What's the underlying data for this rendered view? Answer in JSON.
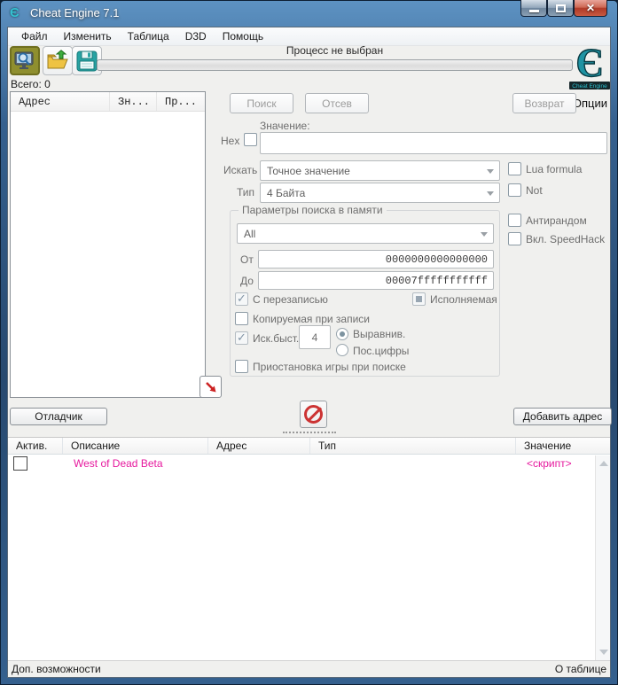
{
  "window": {
    "title": "Cheat Engine 7.1"
  },
  "menu": {
    "items": [
      "Файл",
      "Изменить",
      "Таблица",
      "D3D",
      "Помощь"
    ]
  },
  "toolbar": {
    "process_status": "Процесс не выбран",
    "progress_percent": 0,
    "icons": [
      "select-process",
      "open-table",
      "save-table"
    ]
  },
  "logo": {
    "glyph": "Є",
    "caption": "Cheat Engine",
    "options_label": "Опции"
  },
  "found": {
    "total_label": "Всего: 0",
    "columns": {
      "address": "Адрес",
      "value": "Зн...",
      "previous": "Пр..."
    }
  },
  "scan": {
    "first_scan_label": "Поиск",
    "next_scan_label": "Отсев",
    "undo_label": "Возврат",
    "value_label": "Значение:",
    "hex_label": "Hex",
    "value_input": "",
    "scan_type_label": "Искать",
    "scan_type_value": "Точное значение",
    "value_type_label": "Тип",
    "value_type_value": "4 Байта",
    "lua_formula_label": "Lua formula",
    "not_label": "Not",
    "antirandom_label": "Антирандом",
    "speedhack_label": "Вкл. SpeedHack",
    "memory_group_title": "Параметры поиска в памяти",
    "region_value": "All",
    "from_label": "От",
    "from_value": "0000000000000000",
    "to_label": "До",
    "to_value": "00007fffffffffff",
    "writable_label": "С перезаписью",
    "executable_label": "Исполняемая",
    "copy_on_write_label": "Копируемая при записи",
    "fast_scan_label": "Иск.быст.",
    "fast_scan_value": "4",
    "aligned_label": "Выравнив.",
    "last_digits_label": "Пос.цифры",
    "pause_label": "Приостановка игры при поиске"
  },
  "actions": {
    "debugger_label": "Отладчик",
    "add_address_label": "Добавить адрес"
  },
  "table": {
    "columns": {
      "active": "Актив.",
      "description": "Описание",
      "address": "Адрес",
      "type": "Тип",
      "value": "Значение"
    },
    "rows": [
      {
        "description": "West of Dead Beta",
        "address": "",
        "type": "",
        "value": "<скрипт>"
      }
    ]
  },
  "statusbar": {
    "left": "Доп. возможности",
    "right": "О таблице"
  },
  "colors": {
    "row_magenta": "#E6199E",
    "logo_teal": "#1F93A3",
    "selected_tool_olive": "#8F8F2F",
    "close_button_red": "#C34A3C",
    "frame_blue": "#35608E"
  }
}
